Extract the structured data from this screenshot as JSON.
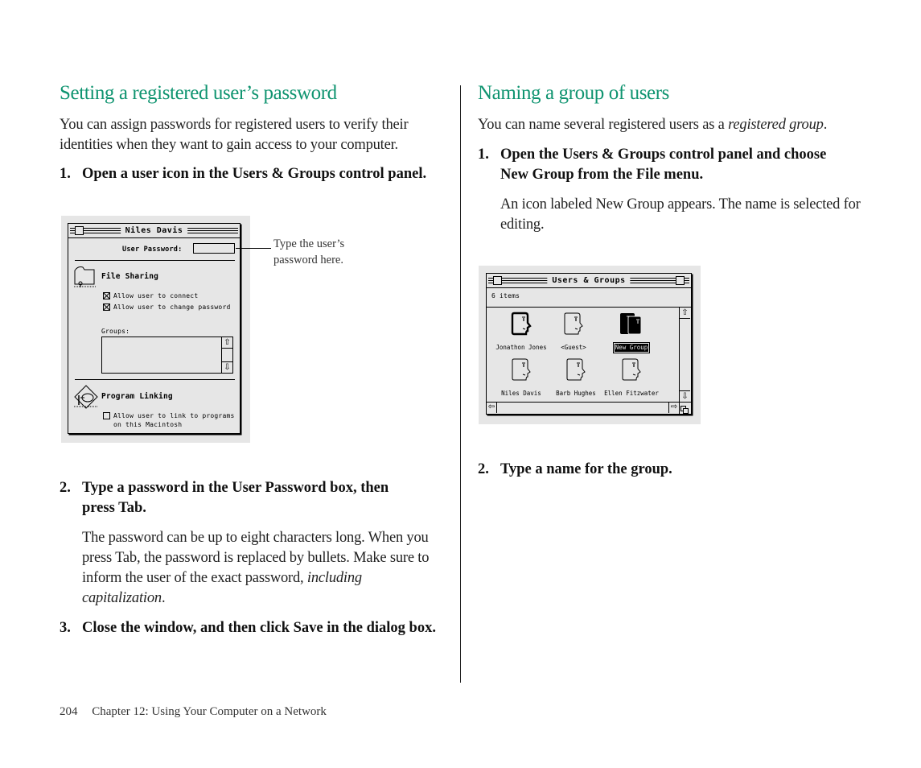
{
  "left_section": {
    "heading": "Setting a registered user’s password",
    "intro": "You can assign passwords for registered users to verify their identities when they want to gain access to your computer.",
    "steps": [
      {
        "num": "1.",
        "text": "Open a user icon in the Users & Groups control panel."
      },
      {
        "num": "2.",
        "text": "Type a password in the User Password box, then press Tab.",
        "detail_before_italic": "The password can be up to eight characters long. When you press Tab, the password is replaced by bullets. Make sure to inform the user of the exact password, ",
        "detail_italic": "including capitalization",
        "detail_after_italic": "."
      },
      {
        "num": "3.",
        "text": "Close the window, and then click Save in the dialog box."
      }
    ],
    "callout": "Type the user’s password here.",
    "user_window": {
      "title": "Niles Davis",
      "password_label": "User Password:",
      "password_value": "",
      "file_sharing": {
        "title": "File Sharing",
        "icon": "folder-share-icon",
        "options": [
          {
            "label": "Allow user to connect",
            "checked": true
          },
          {
            "label": "Allow user to change password",
            "checked": true
          }
        ]
      },
      "groups_label": "Groups:",
      "groups": [],
      "program_linking": {
        "title": "Program Linking",
        "icon": "program-linking-icon",
        "options": [
          {
            "label_line1": "Allow user to link to programs",
            "label_line2": "on this Macintosh",
            "checked": false
          }
        ]
      }
    }
  },
  "right_section": {
    "heading": "Naming a group of users",
    "intro_plain": "You can name several registered users as a ",
    "intro_italic": "registered group",
    "intro_end": ".",
    "steps": [
      {
        "num": "1.",
        "text": "Open the Users & Groups control panel and choose New Group from the File menu.",
        "detail": "An icon labeled New Group appears. The name is selected for editing."
      },
      {
        "num": "2.",
        "text": "Type a name for the group."
      }
    ],
    "groups_window": {
      "title": "Users & Groups",
      "item_count": "6 items",
      "items": [
        {
          "label": "Jonathon Jones",
          "type": "user",
          "selected": false
        },
        {
          "label": "<Guest>",
          "type": "guest",
          "selected": false
        },
        {
          "label": "New Group",
          "type": "group",
          "selected": true
        },
        {
          "label": "Niles Davis",
          "type": "user",
          "selected": false
        },
        {
          "label": "Barb Hughes",
          "type": "user",
          "selected": false
        },
        {
          "label": "Ellen Fitzwater",
          "type": "user",
          "selected": false
        }
      ]
    }
  },
  "footer": {
    "page_number": "204",
    "chapter": "Chapter 12: Using Your Computer on a Network"
  },
  "colors": {
    "heading": "#0f9470",
    "screenshot_bg": "#e6e6e6"
  }
}
